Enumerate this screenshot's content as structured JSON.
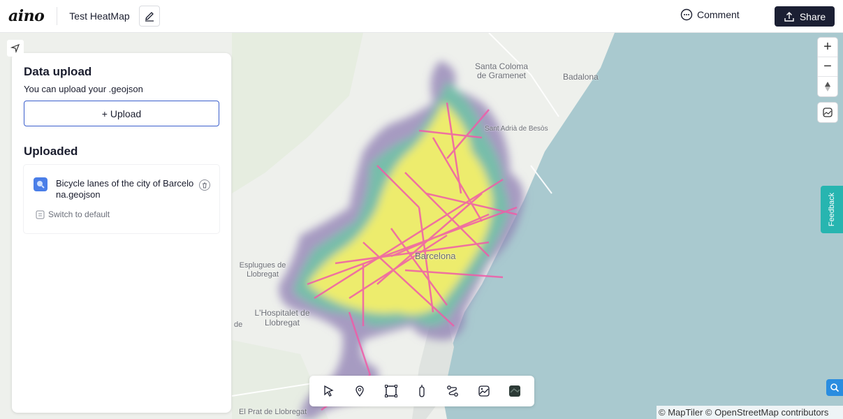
{
  "header": {
    "logo": "aino",
    "project_title": "Test HeatMap",
    "comment_label": "Comment",
    "share_label": "Share"
  },
  "panel": {
    "title": "Data upload",
    "subtitle": "You can upload your .geojson",
    "upload_label": "+ Upload",
    "uploaded_title": "Uploaded",
    "file_name": "Bicycle lanes of the city of Barcelona.geojson",
    "switch_label": "Switch to default"
  },
  "map": {
    "labels": {
      "santa_coloma": "Santa Coloma de Gramenet",
      "badalona": "Badalona",
      "sant_adria": "Sant Adrià de Besòs",
      "barcelona": "Barcelona",
      "esplugues": "Esplugues de Llobregat",
      "hospitalet": "L'Hospitalet de Llobregat",
      "el_prat": "El Prat de Llobregat",
      "de": "de"
    },
    "zoom_in": "+",
    "zoom_out": "−",
    "attribution": "© MapTiler © OpenStreetMap contributors"
  },
  "feedback_label": "Feedback",
  "toolbar": {
    "icons": [
      "cursor-icon",
      "pin-icon",
      "rectangle-icon",
      "marker-pen-icon",
      "route-icon",
      "image-icon",
      "satellite-icon"
    ]
  },
  "colors": {
    "sea": "#a9c9cf",
    "land": "#eef0ec",
    "heat_low": "#8f7fb3",
    "heat_mid": "#6cc6a4",
    "heat_high": "#f4ef6a",
    "lanes": "#f05ca8",
    "accent": "#1b1f33"
  }
}
